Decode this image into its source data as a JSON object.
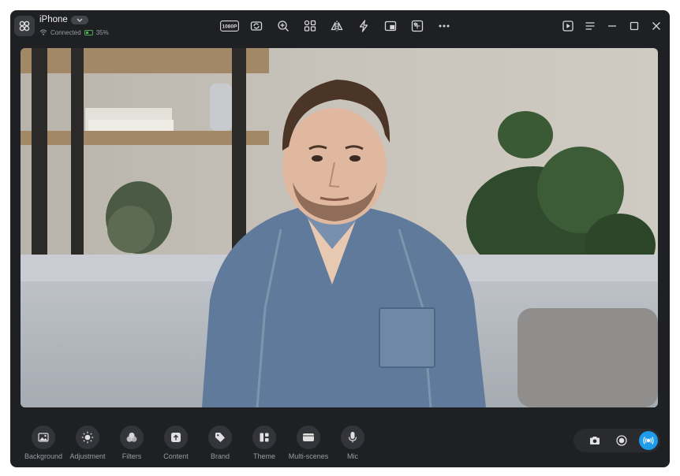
{
  "device": {
    "name": "iPhone",
    "status": "Connected",
    "battery": "35%"
  },
  "toolbar": {
    "resolution_label": "1080P",
    "icons": [
      "rotate-icon",
      "zoom-in-icon",
      "layout-grid-icon",
      "mirror-icon",
      "flash-icon",
      "pip-icon",
      "crop-icon",
      "more-icon"
    ]
  },
  "window_controls": [
    "play-video-icon",
    "menu-icon",
    "minimize-icon",
    "maximize-icon",
    "close-icon"
  ],
  "tools": [
    {
      "label": "Background",
      "icon": "image-icon"
    },
    {
      "label": "Adjustment",
      "icon": "brightness-icon"
    },
    {
      "label": "Filters",
      "icon": "filters-icon"
    },
    {
      "label": "Content",
      "icon": "upload-icon"
    },
    {
      "label": "Brand",
      "icon": "tag-icon"
    },
    {
      "label": "Theme",
      "icon": "theme-icon"
    },
    {
      "label": "Multi-scenes",
      "icon": "scenes-icon"
    },
    {
      "label": "Mic",
      "icon": "mic-icon"
    }
  ],
  "capture": [
    "camera-icon",
    "record-icon",
    "live-icon"
  ],
  "colors": {
    "window_bg": "#1f2023",
    "accent": "#1e9bea",
    "battery": "#4caf50"
  }
}
